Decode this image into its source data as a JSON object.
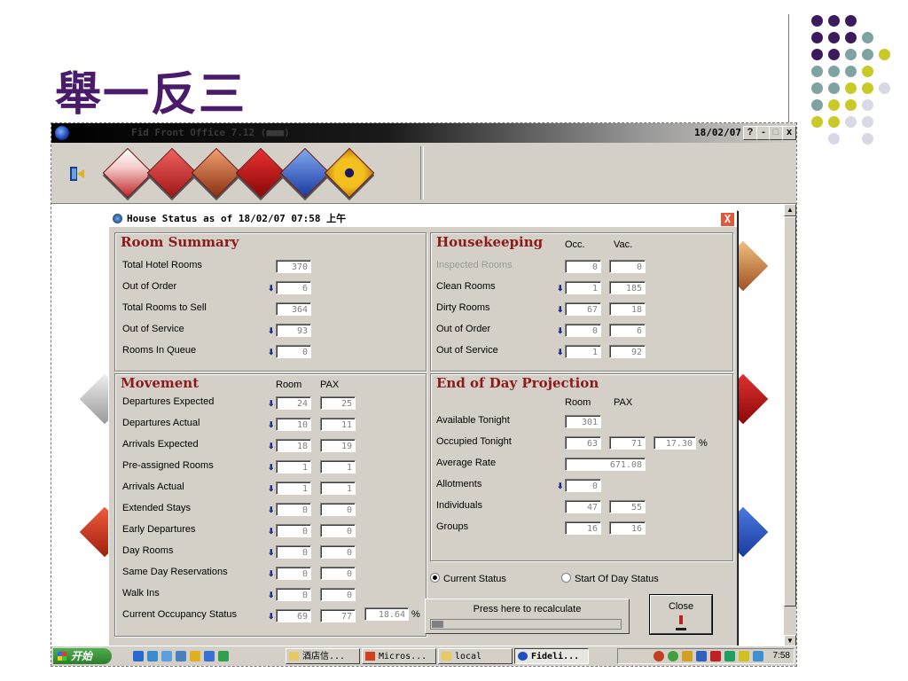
{
  "slide": {
    "title": "舉一反三",
    "dot_colors": [
      "#3d1a5e",
      "#7ea3a1",
      "#c9c928",
      "#d9d9e6"
    ]
  },
  "window": {
    "title": "Fid  Front Office 7.12 (■■■)",
    "date": "18/02/07",
    "help_label": "?",
    "min_label": "-",
    "max_label": "□",
    "close_label": "x"
  },
  "toolbar": {
    "icons": [
      "exit-icon",
      "front-desk-icon",
      "reservations-icon",
      "cashier-icon",
      "night-audit-icon",
      "reports-icon",
      "eye-icon"
    ],
    "diamond_colors": [
      "#c0282d",
      "#c0282d",
      "#b5411f",
      "#c0282d",
      "#3563c8",
      "#e2b023"
    ]
  },
  "dialog": {
    "title": "House Status as of 18/02/07 07:58 上午",
    "close_label": "X",
    "room_summary": {
      "title": "Room Summary",
      "rows": [
        {
          "label": "Total Hotel Rooms",
          "value": "370"
        },
        {
          "label": "Out of Order",
          "value": "6"
        },
        {
          "label": "Total Rooms to Sell",
          "value": "364"
        },
        {
          "label": "Out of Service",
          "value": "93"
        },
        {
          "label": "Rooms In Queue",
          "value": "0"
        }
      ]
    },
    "housekeeping": {
      "title": "Housekeeping",
      "col_occ": "Occ.",
      "col_vac": "Vac.",
      "rows": [
        {
          "label": "Inspected Rooms",
          "occ": "0",
          "vac": "0"
        },
        {
          "label": "Clean Rooms",
          "occ": "1",
          "vac": "185"
        },
        {
          "label": "Dirty Rooms",
          "occ": "67",
          "vac": "18"
        },
        {
          "label": "Out of Order",
          "occ": "0",
          "vac": "6"
        },
        {
          "label": "Out of Service",
          "occ": "1",
          "vac": "92"
        }
      ]
    },
    "movement": {
      "title": "Movement",
      "col_room": "Room",
      "col_pax": "PAX",
      "rows": [
        {
          "label": "Departures Expected",
          "room": "24",
          "pax": "25"
        },
        {
          "label": "Departures Actual",
          "room": "10",
          "pax": "11"
        },
        {
          "label": "Arrivals Expected",
          "room": "18",
          "pax": "19"
        },
        {
          "label": "Pre-assigned Rooms",
          "room": "1",
          "pax": "1"
        },
        {
          "label": "Arrivals Actual",
          "room": "1",
          "pax": "1"
        },
        {
          "label": "Extended Stays",
          "room": "0",
          "pax": "0"
        },
        {
          "label": "Early Departures",
          "room": "0",
          "pax": "0"
        },
        {
          "label": "Day Rooms",
          "room": "0",
          "pax": "0"
        },
        {
          "label": "Same Day Reservations",
          "room": "0",
          "pax": "0"
        },
        {
          "label": "Walk Ins",
          "room": "0",
          "pax": "0"
        },
        {
          "label": "Current Occupancy Status",
          "room": "69",
          "pax": "77"
        }
      ],
      "occupancy_pct": "18.64",
      "pct_sign": "%"
    },
    "end_of_day": {
      "title": "End of Day Projection",
      "col_room": "Room",
      "col_pax": "PAX",
      "available_tonight": {
        "label": "Available Tonight",
        "room": "301"
      },
      "occupied_tonight": {
        "label": "Occupied Tonight",
        "room": "63",
        "pax": "71",
        "pct": "17.30",
        "pct_sign": "%"
      },
      "average_rate": {
        "label": "Average Rate",
        "value": "671.08"
      },
      "allotments": {
        "label": "Allotments",
        "room": "0"
      },
      "individuals": {
        "label": "Individuals",
        "room": "47",
        "pax": "55"
      },
      "groups": {
        "label": "Groups",
        "room": "16",
        "pax": "16"
      }
    },
    "status_options": {
      "current": "Current Status",
      "start_of_day": "Start Of Day Status",
      "selected": "current"
    },
    "recalc": {
      "label": "Press here to recalculate",
      "progress": 0.06
    },
    "close_button": "Close"
  },
  "taskbar": {
    "start_label": "开始",
    "tasks": [
      {
        "label": "酒店信...",
        "icon": "folder-icon"
      },
      {
        "label": "Micros...",
        "icon": "app-icon"
      },
      {
        "label": "local",
        "icon": "folder-icon"
      },
      {
        "label": "Fideli...",
        "icon": "fidelio-icon"
      }
    ],
    "clock": "7:58"
  }
}
